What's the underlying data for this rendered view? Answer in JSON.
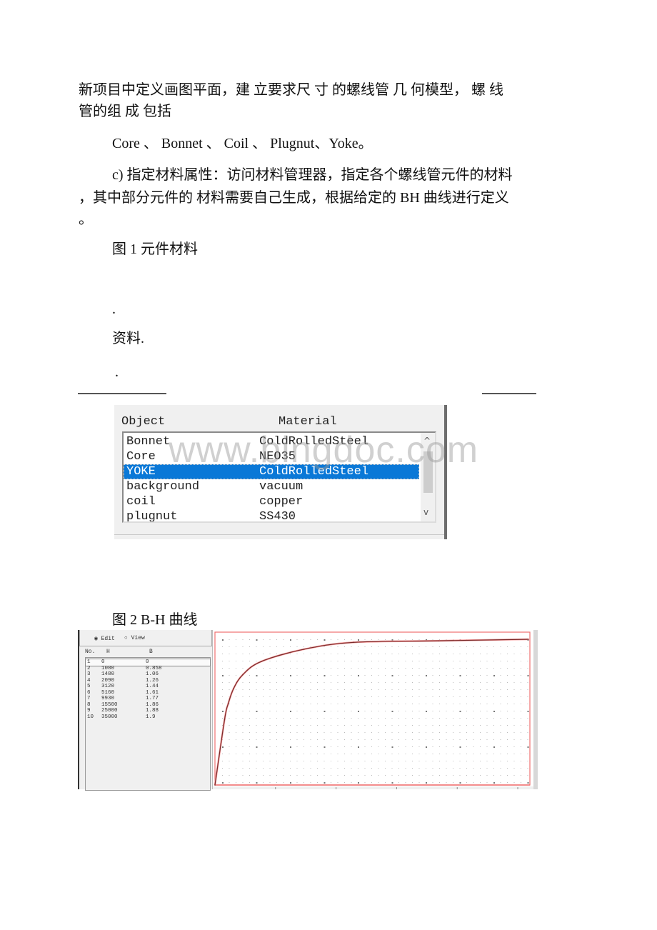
{
  "paragraphs": {
    "intro_line1": "新项目中定义画图平面，建 立要求尺 寸 的螺线管 几 何模型， 螺 线",
    "intro_line2": "管的组 成 包括",
    "components": "Core 、 Bonnet 、 Coil 、 Plugnut、Yoke。",
    "material_line1": "c) 指定材料属性：访问材料管理器，指定各个螺线管元件的材料",
    "material_line2": "，其中部分元件的 材料需要自己生成，根据给定的 BH 曲线进行定义",
    "material_line3": "。",
    "fig1_caption": "图 1 元件材料",
    "dot1": ".",
    "resource": "资料.",
    "dot2": ".",
    "fig2_caption": "图 2 B-H 曲线"
  },
  "watermark": "www.bingdoc.com",
  "material_dialog": {
    "col_object": "Object",
    "col_material": "Material",
    "rows": [
      {
        "object": "Bonnet",
        "material": "ColdRolledSteel",
        "selected": false
      },
      {
        "object": "Core",
        "material": "NEO35",
        "selected": false
      },
      {
        "object": "YOKE",
        "material": "ColdRolledSteel",
        "selected": true
      },
      {
        "object": "background",
        "material": "vacuum",
        "selected": false
      },
      {
        "object": "coil",
        "material": "copper",
        "selected": false
      },
      {
        "object": "plugnut",
        "material": "SS430",
        "selected": false
      }
    ],
    "scroll_up": "^",
    "scroll_down": "v",
    "selection_color": "#0a78d7"
  },
  "bh_editor": {
    "mode_edit": "Edit",
    "mode_view": "View",
    "selected_mode": "Edit",
    "col_no": "No.",
    "col_h": "H",
    "col_b": "B",
    "rows": [
      {
        "no": "1",
        "h": "0",
        "b": "0"
      },
      {
        "no": "2",
        "h": "1080",
        "b": "0.858"
      },
      {
        "no": "3",
        "h": "1480",
        "b": "1.06"
      },
      {
        "no": "4",
        "h": "2090",
        "b": "1.26"
      },
      {
        "no": "5",
        "h": "3120",
        "b": "1.44"
      },
      {
        "no": "6",
        "h": "5160",
        "b": "1.61"
      },
      {
        "no": "7",
        "h": "9930",
        "b": "1.77"
      },
      {
        "no": "8",
        "h": "15500",
        "b": "1.86"
      },
      {
        "no": "9",
        "h": "25000",
        "b": "1.88"
      },
      {
        "no": "10",
        "h": "35000",
        "b": "1.9"
      }
    ],
    "curve_color": "#7a2a2a",
    "frame_color": "#f07070"
  },
  "chart_data": {
    "type": "line",
    "title": "",
    "xlabel": "H",
    "ylabel": "B",
    "x": [
      0,
      1080,
      1480,
      2090,
      3120,
      5160,
      9930,
      15500,
      25000,
      35000
    ],
    "series": [
      {
        "name": "B-H",
        "values": [
          0,
          0.858,
          1.06,
          1.26,
          1.44,
          1.61,
          1.77,
          1.86,
          1.88,
          1.9
        ]
      }
    ],
    "xlim": [
      0,
      35000
    ],
    "ylim": [
      0,
      1.9
    ],
    "grid": true
  }
}
